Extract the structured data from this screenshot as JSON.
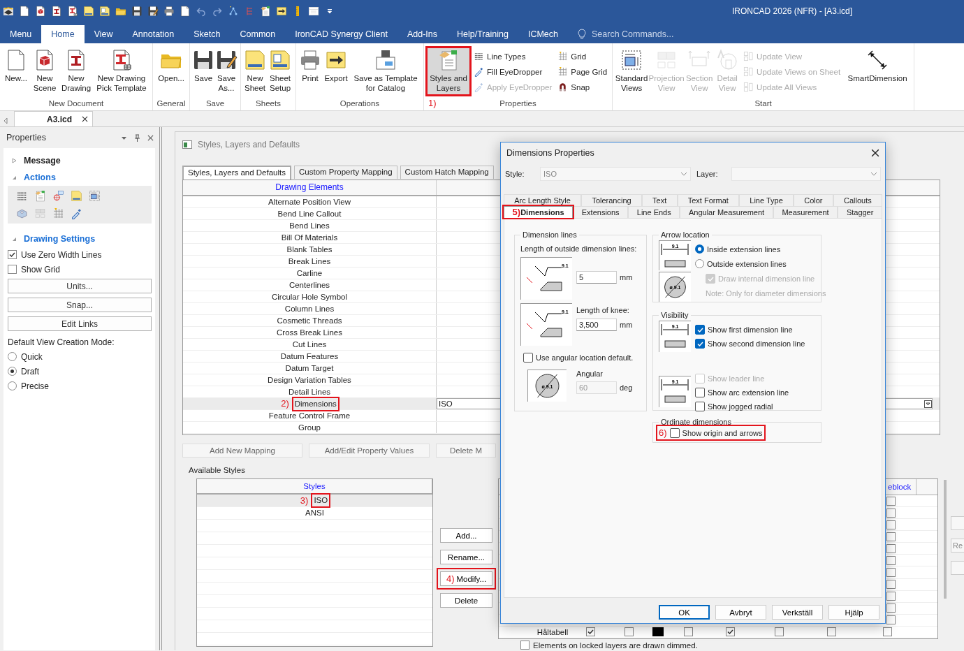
{
  "title_bar": {
    "title": "IRONCAD 2026 (NFR) - [A3.icd]"
  },
  "ribbon": {
    "tabs": [
      {
        "label": "Menu",
        "selected": false
      },
      {
        "label": "Home",
        "selected": true
      },
      {
        "label": "View",
        "selected": false
      },
      {
        "label": "Annotation",
        "selected": false
      },
      {
        "label": "Sketch",
        "selected": false
      },
      {
        "label": "Common",
        "selected": false
      },
      {
        "label": "IronCAD Synergy Client",
        "selected": false
      },
      {
        "label": "Add-Ins",
        "selected": false
      },
      {
        "label": "Help/Training",
        "selected": false
      },
      {
        "label": "ICMech",
        "selected": false
      }
    ],
    "search": {
      "placeholder": "Search Commands..."
    },
    "groups": [
      {
        "label": "New Document",
        "items": [
          {
            "kind": "large",
            "label": "New...",
            "disabled": false,
            "pressed": false
          },
          {
            "kind": "large",
            "label": "New Scene",
            "disabled": false,
            "pressed": false
          },
          {
            "kind": "large",
            "label": "New Drawing",
            "disabled": false,
            "pressed": false
          },
          {
            "kind": "large",
            "label": "New Drawing Pick Template",
            "disabled": false,
            "pressed": false
          }
        ]
      },
      {
        "label": "General",
        "items": [
          {
            "kind": "large",
            "label": "Open...",
            "disabled": false,
            "pressed": false
          }
        ]
      },
      {
        "label": "Save",
        "items": [
          {
            "kind": "large",
            "label": "Save",
            "disabled": false,
            "pressed": false
          },
          {
            "kind": "large",
            "label": "Save As...",
            "disabled": false,
            "pressed": false
          }
        ]
      },
      {
        "label": "Sheets",
        "items": [
          {
            "kind": "large",
            "label": "New Sheet",
            "disabled": false,
            "pressed": false
          },
          {
            "kind": "large",
            "label": "Sheet Setup",
            "disabled": false,
            "pressed": false
          }
        ]
      },
      {
        "label": "Operations",
        "items": [
          {
            "kind": "large",
            "label": "Print",
            "disabled": false,
            "pressed": false
          },
          {
            "kind": "large",
            "label": "Export",
            "disabled": false,
            "pressed": false
          },
          {
            "kind": "large",
            "label": "Save as Template for Catalog",
            "disabled": false,
            "pressed": false
          }
        ]
      },
      {
        "label": "Properties",
        "items": [
          {
            "kind": "large",
            "label": "Styles and Layers",
            "disabled": false,
            "pressed": true,
            "annotation": "1)"
          },
          {
            "kind": "small",
            "label": "Line Types",
            "disabled": false,
            "pressed": false
          },
          {
            "kind": "small",
            "label": "Fill EyeDropper",
            "disabled": false,
            "pressed": false
          },
          {
            "kind": "small",
            "label": "Apply EyeDropper",
            "disabled": true,
            "pressed": false
          },
          {
            "kind": "small",
            "label": "Grid",
            "disabled": false,
            "pressed": false
          },
          {
            "kind": "small",
            "label": "Page Grid",
            "disabled": false,
            "pressed": false
          },
          {
            "kind": "small",
            "label": "Snap",
            "disabled": false,
            "pressed": false
          }
        ]
      },
      {
        "label": "Start",
        "items": [
          {
            "kind": "large",
            "label": "Standard Views",
            "disabled": false,
            "pressed": false
          },
          {
            "kind": "large",
            "label": "Projection View",
            "disabled": true,
            "pressed": false
          },
          {
            "kind": "large",
            "label": "Section View",
            "disabled": true,
            "pressed": false
          },
          {
            "kind": "large",
            "label": "Detail View",
            "disabled": true,
            "pressed": false
          },
          {
            "kind": "small",
            "label": "Update View",
            "disabled": true,
            "pressed": false
          },
          {
            "kind": "small",
            "label": "Update Views on Sheet",
            "disabled": true,
            "pressed": false
          },
          {
            "kind": "small",
            "label": "Update All Views",
            "disabled": true,
            "pressed": false
          },
          {
            "kind": "large",
            "label": "SmartDimension",
            "disabled": false,
            "pressed": false
          }
        ]
      }
    ]
  },
  "doc_tabs": [
    {
      "label": "A3.icd",
      "selected": true
    }
  ],
  "properties_panel": {
    "title": "Properties",
    "sections": [
      {
        "label": "Message",
        "expanded": false
      },
      {
        "label": "Actions",
        "expanded": true
      },
      {
        "label": "Drawing Settings",
        "expanded": true
      }
    ],
    "checkboxes": [
      {
        "label": "Use Zero Width Lines",
        "checked": true
      },
      {
        "label": "Show Grid",
        "checked": false
      }
    ],
    "buttons": [
      "Units...",
      "Snap...",
      "Edit Links"
    ],
    "mode_label": "Default View Creation Mode:",
    "modes": [
      {
        "label": "Quick",
        "selected": false
      },
      {
        "label": "Draft",
        "selected": true
      },
      {
        "label": "Precise",
        "selected": false
      }
    ]
  },
  "styles_panel": {
    "title": "Styles, Layers and Defaults",
    "tabs": [
      {
        "label": "Styles, Layers and Defaults",
        "selected": true
      },
      {
        "label": "Custom Property Mapping",
        "selected": false
      },
      {
        "label": "Custom Hatch Mapping",
        "selected": false
      }
    ],
    "column": "Drawing Elements",
    "rows": [
      {
        "name": "Alternate Position View",
        "selected": false
      },
      {
        "name": "Bend Line Callout",
        "selected": false
      },
      {
        "name": "Bend Lines",
        "selected": false
      },
      {
        "name": "Bill Of Materials",
        "selected": false
      },
      {
        "name": "Blank Tables",
        "selected": false
      },
      {
        "name": "Break Lines",
        "selected": false
      },
      {
        "name": "Carline",
        "selected": false
      },
      {
        "name": "Centerlines",
        "selected": false
      },
      {
        "name": "Circular Hole Symbol",
        "selected": false
      },
      {
        "name": "Column Lines",
        "selected": false
      },
      {
        "name": "Cosmetic Threads",
        "selected": false
      },
      {
        "name": "Cross Break Lines",
        "selected": false
      },
      {
        "name": "Cut Lines",
        "selected": false
      },
      {
        "name": "Datum Features",
        "selected": false
      },
      {
        "name": "Datum Target",
        "selected": false
      },
      {
        "name": "Design Variation Tables",
        "selected": false
      },
      {
        "name": "Detail Lines",
        "selected": false
      },
      {
        "name": "Dimensions",
        "selected": true,
        "style": "ISO",
        "annotation": "2)"
      },
      {
        "name": "Feature Control Frame",
        "selected": false
      },
      {
        "name": "Group",
        "selected": false
      }
    ],
    "buttons": [
      "Add New Mapping",
      "Add/Edit Property Values",
      "Delete M"
    ],
    "available_label": "Available Styles",
    "styles_column": "Styles",
    "styles": [
      {
        "name": "ISO",
        "selected": true,
        "annotation": "3)"
      },
      {
        "name": "ANSI",
        "selected": false
      }
    ],
    "style_buttons": [
      {
        "label": "Add..."
      },
      {
        "label": "Rename..."
      },
      {
        "label": "Modify...",
        "annotation": "4)"
      },
      {
        "label": "Delete"
      }
    ],
    "layers": {
      "header": "eblock",
      "column_checks": [
        false,
        false,
        false,
        false,
        false,
        false,
        false,
        false,
        false,
        false,
        false
      ],
      "row": {
        "name": "Håltabell",
        "cells": [
          {
            "kind": "check",
            "checked": true
          },
          {
            "kind": "check",
            "checked": false
          },
          {
            "kind": "swatch",
            "color": "#000000"
          },
          {
            "kind": "check",
            "checked": false
          },
          {
            "kind": "check",
            "checked": true
          },
          {
            "kind": "check",
            "checked": false
          },
          {
            "kind": "check",
            "checked": false
          },
          {
            "kind": "check",
            "checked": false
          }
        ]
      }
    },
    "locked": {
      "label": "Elements on locked layers are drawn dimmed.",
      "checked": false
    },
    "edge_button": "Re"
  },
  "dialog": {
    "title": "Dimensions Properties",
    "style_label": "Style:",
    "style_value": "ISO",
    "layer_label": "Layer:",
    "tab_rows": [
      [
        {
          "label": "Arc Length Style",
          "selected": false
        },
        {
          "label": "Tolerancing",
          "selected": false
        },
        {
          "label": "Text",
          "selected": false
        },
        {
          "label": "Text Format",
          "selected": false
        },
        {
          "label": "Line Type",
          "selected": false
        },
        {
          "label": "Color",
          "selected": false
        },
        {
          "label": "Callouts",
          "selected": false
        }
      ],
      [
        {
          "label": "Dimensions",
          "selected": true,
          "annotation": "5)"
        },
        {
          "label": "Extensions",
          "selected": false
        },
        {
          "label": "Line Ends",
          "selected": false
        },
        {
          "label": "Angular Measurement",
          "selected": false
        },
        {
          "label": "Measurement",
          "selected": false
        },
        {
          "label": "Stagger",
          "selected": false
        }
      ]
    ],
    "dimension_lines": {
      "title": "Dimension lines",
      "outside_label": "Length of outside dimension lines:",
      "diagrams": [
        "9.1",
        "9.1",
        "ø 9.1"
      ],
      "outside_value": "5",
      "outside_unit": "mm",
      "knee_label": "Length of knee:",
      "knee_value": "3,500",
      "knee_unit": "mm",
      "angular_default": {
        "label": "Use angular location default.",
        "checked": false
      },
      "angular_label": "Angular",
      "angular_value": "60",
      "angular_unit": "deg"
    },
    "arrow_location": {
      "title": "Arrow location",
      "diagrams": [
        "9.1",
        "ø 9.1"
      ],
      "options": [
        {
          "label": "Inside extension lines",
          "selected": true
        },
        {
          "label": "Outside extension lines",
          "selected": false
        }
      ],
      "internal": {
        "label": "Draw internal dimension line",
        "checked": true,
        "disabled": true
      },
      "note": "Note: Only for diameter dimensions"
    },
    "visibility": {
      "title": "Visibility",
      "diagrams": [
        "9.1",
        "9.1"
      ],
      "checks": [
        {
          "label": "Show first dimension line",
          "checked": true,
          "disabled": false
        },
        {
          "label": "Show second dimension line",
          "checked": true,
          "disabled": false
        },
        {
          "label": "Show leader line",
          "checked": false,
          "disabled": true
        },
        {
          "label": "Show arc extension line",
          "checked": false,
          "disabled": false
        },
        {
          "label": "Show jogged radial",
          "checked": false,
          "disabled": false
        }
      ]
    },
    "ordinate": {
      "title": "Ordinate dimensions",
      "label": "Show origin and arrows",
      "checked": false,
      "annotation": "6)"
    },
    "buttons": [
      {
        "label": "OK",
        "default": true
      },
      {
        "label": "Avbryt",
        "default": false
      },
      {
        "label": "Verkställ",
        "default": false
      },
      {
        "label": "Hjälp",
        "default": false
      }
    ]
  }
}
